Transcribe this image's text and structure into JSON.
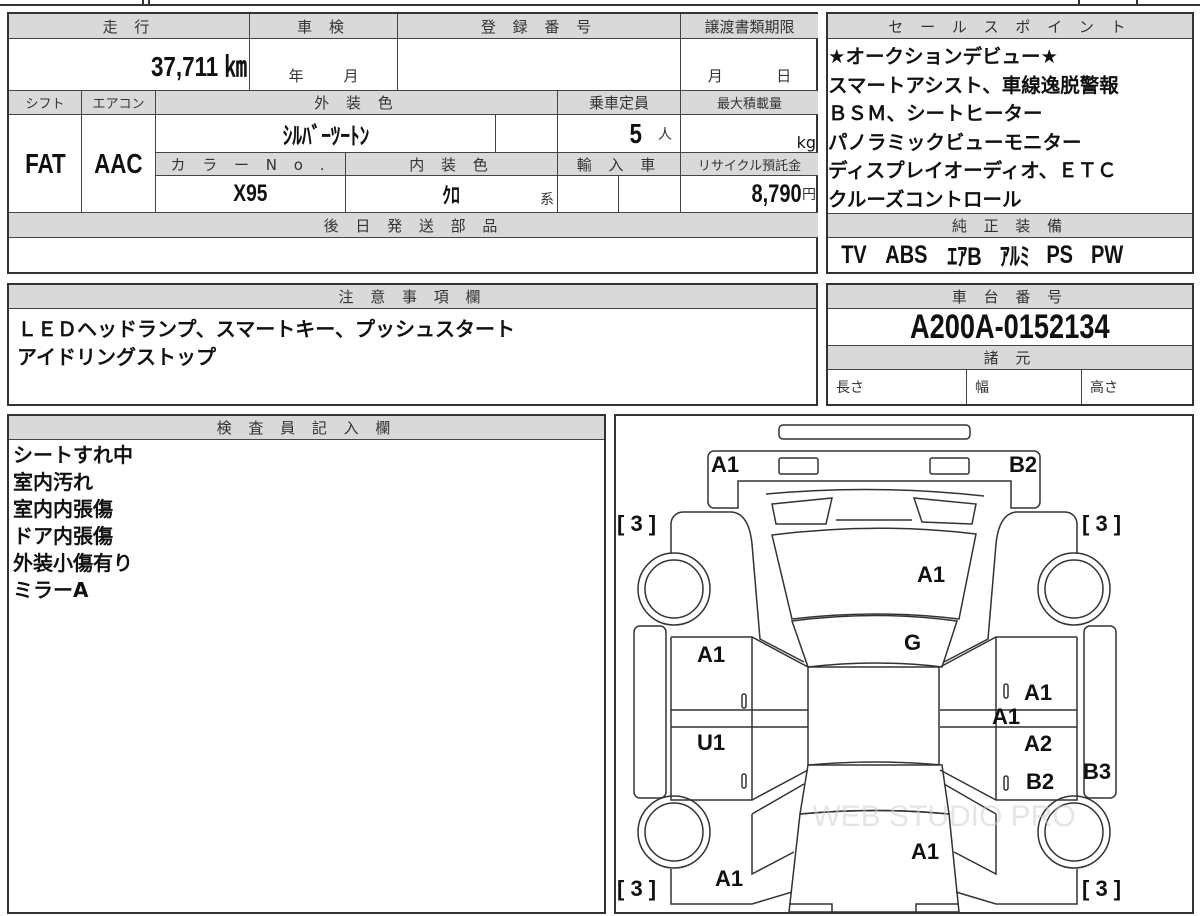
{
  "main_table": {
    "headers": {
      "mileage": "走 行",
      "inspection": "車 検",
      "registration": "登 録 番 号",
      "transfer_deadline": "譲渡書類期限",
      "shift": "シフト",
      "aircon": "エアコン",
      "exterior_color": "外 装 色",
      "capacity": "乗車定員",
      "max_load": "最大積載量",
      "color_no": "カ ラ ー N o .",
      "interior_color": "内 装 色",
      "import": "輸 入 車",
      "recycle_fee": "リサイクル預託金",
      "later_parts": "後 日 発 送 部 品"
    },
    "mileage": "37,711 ㎞",
    "inspection_year": "年",
    "inspection_month": "月",
    "transfer_month": "月",
    "transfer_day": "日",
    "shift": "FAT",
    "aircon": "AAC",
    "exterior_color": "ｼﾙﾊﾞｰﾂｰﾄﾝ",
    "capacity": "5",
    "capacity_unit": "人",
    "max_load_unit": "kg",
    "color_no": "X95",
    "interior_color": "ｸﾛ",
    "interior_suffix": "系",
    "recycle_fee": "8,790",
    "recycle_unit": "円"
  },
  "sales_points": {
    "header": "セ ー ル ス ポ イ ン ト",
    "text": "★オークションデビュー★\nスマートアシスト、車線逸脱警報\nＢＳＭ、シートヒーター\nパノラミックビューモニター\nディスプレイオーディオ、ＥＴＣ\nクルーズコントロール"
  },
  "equipment": {
    "header": "純 正 装 備",
    "items": [
      "TV",
      "ABS",
      "ｴｱB",
      "ｱﾙﾐ",
      "PS",
      "PW"
    ]
  },
  "notes": {
    "header": "注 意 事 項 欄",
    "text": "ＬＥＤヘッドランプ、スマートキー、プッシュスタート\nアイドリングストップ"
  },
  "chassis": {
    "header": "車 台 番 号",
    "number": "A200A-0152134",
    "spec_header": "諸 元",
    "length": "長さ",
    "width": "幅",
    "height": "高さ"
  },
  "inspector": {
    "header": "検 査 員 記 入 欄",
    "text": "シートすれ中\n室内汚れ\n室内内張傷\nドア内張傷\n外装小傷有り\nミラーA"
  },
  "diagram": {
    "marks": [
      "A1",
      "B2",
      "[ 3 ]",
      "[ 3 ]",
      "A1",
      "G",
      "A1",
      "0",
      "0",
      "A1",
      "A1",
      "U1",
      "0",
      "A2",
      "0",
      "B2",
      "B3",
      "A1",
      "A1",
      "[ 3 ]",
      "[ 3 ]"
    ],
    "watermark": "WEB STUDIO PRO"
  }
}
